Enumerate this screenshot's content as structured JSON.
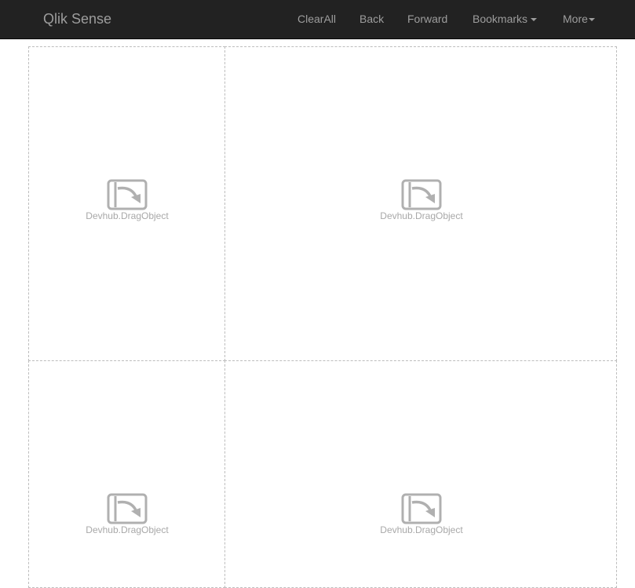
{
  "navbar": {
    "brand": "Qlik Sense",
    "items": [
      {
        "label": "ClearAll"
      },
      {
        "label": "Back"
      },
      {
        "label": "Forward"
      },
      {
        "label": "Bookmarks",
        "dropdown": true
      },
      {
        "label": "More",
        "dropdown": true
      }
    ]
  },
  "objects": [
    {
      "label": "Devhub.DragObject",
      "icon": "extension-object-icon"
    },
    {
      "label": "Devhub.DragObject",
      "icon": "extension-object-icon"
    },
    {
      "label": "Devhub.DragObject",
      "icon": "extension-object-icon"
    },
    {
      "label": "Devhub.DragObject",
      "icon": "extension-object-icon"
    }
  ],
  "colors": {
    "navbar_bg": "#222222",
    "nav_text": "#9d9d9d",
    "placeholder_gray": "#a8a8a8",
    "cell_border": "#bdbdbd"
  }
}
